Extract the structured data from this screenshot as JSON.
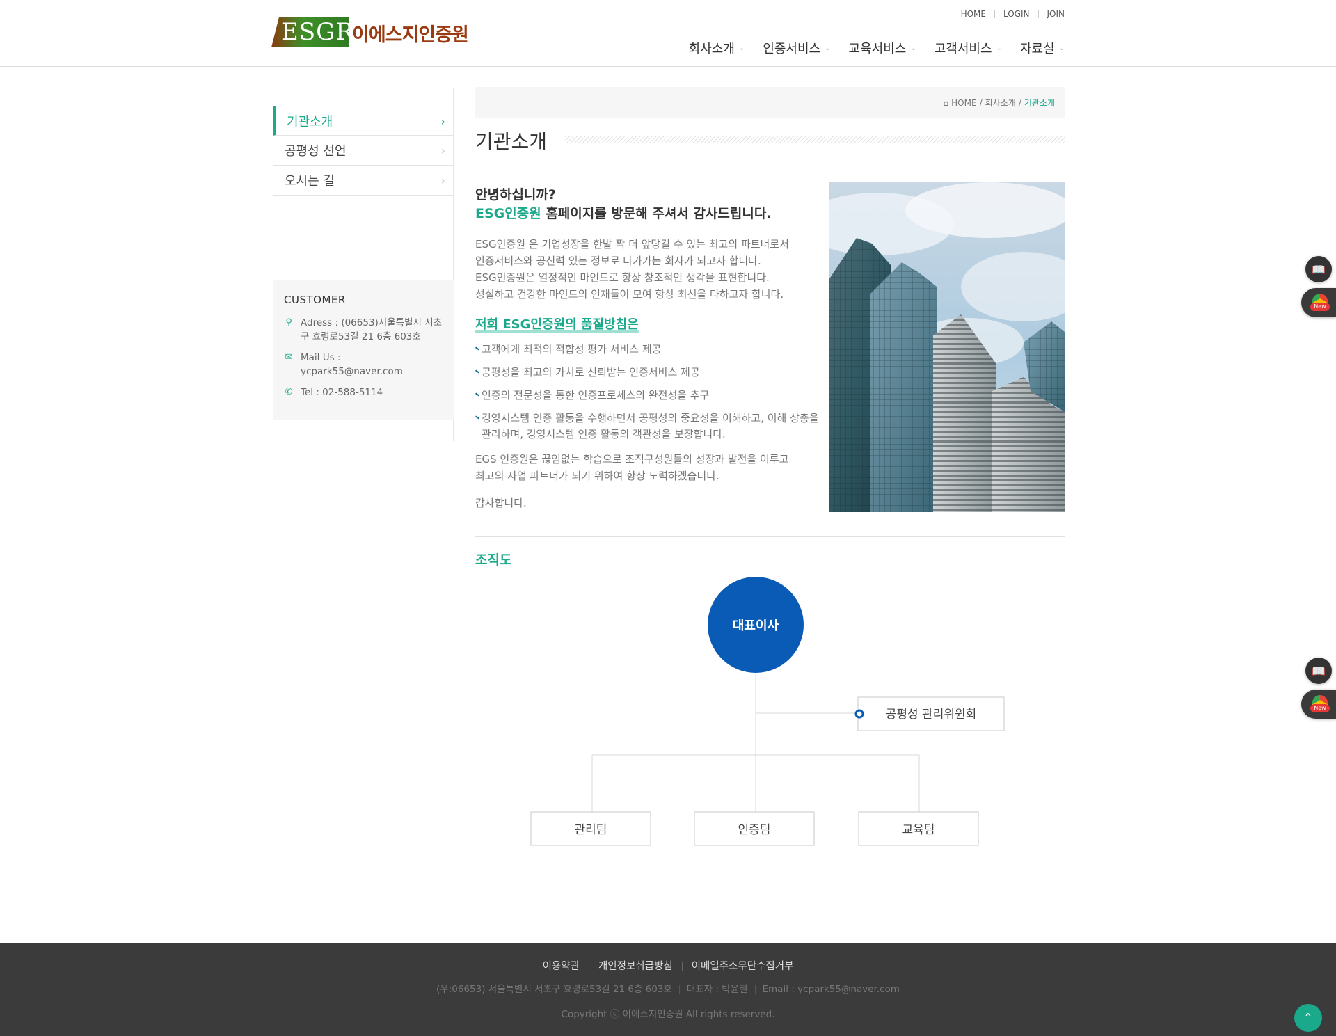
{
  "header": {
    "logo_mark": "ESGR",
    "logo_text": "이에스지인증원",
    "top_links": [
      "HOME",
      "LOGIN",
      "JOIN"
    ],
    "nav": [
      "회사소개",
      "인증서비스",
      "교육서비스",
      "고객서비스",
      "자료실"
    ]
  },
  "sidebar": {
    "items": [
      "기관소개",
      "공평성 선언",
      "오시는 길"
    ],
    "active_index": 0,
    "customer": {
      "title": "CUSTOMER",
      "address": "Adress : (06653)서울특별시 서초구 효령로53길 21 6층 603호",
      "mail": "Mail Us : ycpark55@naver.com",
      "tel": "Tel : 02-588-5114"
    }
  },
  "breadcrumb": {
    "home": "HOME",
    "sep": "/",
    "parent": "회사소개",
    "current": "기관소개"
  },
  "page_title": "기관소개",
  "greeting": {
    "line1": "안녕하십니까?",
    "line2_accent": "ESG인증원",
    "line2_rest": " 홈페이지를 방문해 주셔서 감사드립니다."
  },
  "intro_lines": [
    "ESG인증원 은 기업성장을 한발 짝 더 앞당길 수 있는 최고의 파트너로서",
    "인증서비스와 공신력 있는 정보로 다가가는 회사가 되고자 합니다.",
    "ESG인증원은 열정적인 마인드로 항상 창조적인 생각을 표현합니다.",
    "성실하고 건강한 마인드의 인재들이 모여 항상 최선을 다하고자 합니다."
  ],
  "policy_title": "저희 ESG인증원의 품질방침은",
  "policy_items": [
    "고객에게 최적의 적합성 평가 서비스 제공",
    "공평성을 최고의 가치로 신뢰받는 인증서비스 제공",
    "인증의 전문성을 통한 인증프로세스의 완전성을 추구",
    "경영시스템 인증 활동을 수행하면서 공평성의 중요성을 이해하고, 이해 상충을 관리하며, 경영시스템 인증 활동의 객관성을 보장합니다."
  ],
  "closing_lines": [
    "EGS 인증원은 끊임없는 학습으로 조직구성원들의 성장과 발전을 이루고",
    "최고의 사업 파트너가 되기 위하여 항상 노력하겠습니다."
  ],
  "thanks": "감사합니다.",
  "org": {
    "title": "조직도",
    "ceo": "대표이사",
    "committee": "공평성 관리위원회",
    "teams": [
      "관리팀",
      "인증팀",
      "교육팀"
    ]
  },
  "footer": {
    "links": [
      "이용약관",
      "개인정보취급방침",
      "이메일주소무단수집거부"
    ],
    "info": [
      "(우:06653) 서울특별시 서초구 효령로53길 21 6층 603호",
      "대표자 : 박윤철",
      "Email : ycpark55@naver.com"
    ],
    "copyright": "Copyright ⓒ 이에스지인증원 All rights reserved."
  },
  "floating": {
    "new_badge": "New"
  },
  "colors": {
    "accent": "#1ba98c",
    "ceo_circle": "#0a5bb5",
    "footer_bg": "#3b3b3b"
  }
}
